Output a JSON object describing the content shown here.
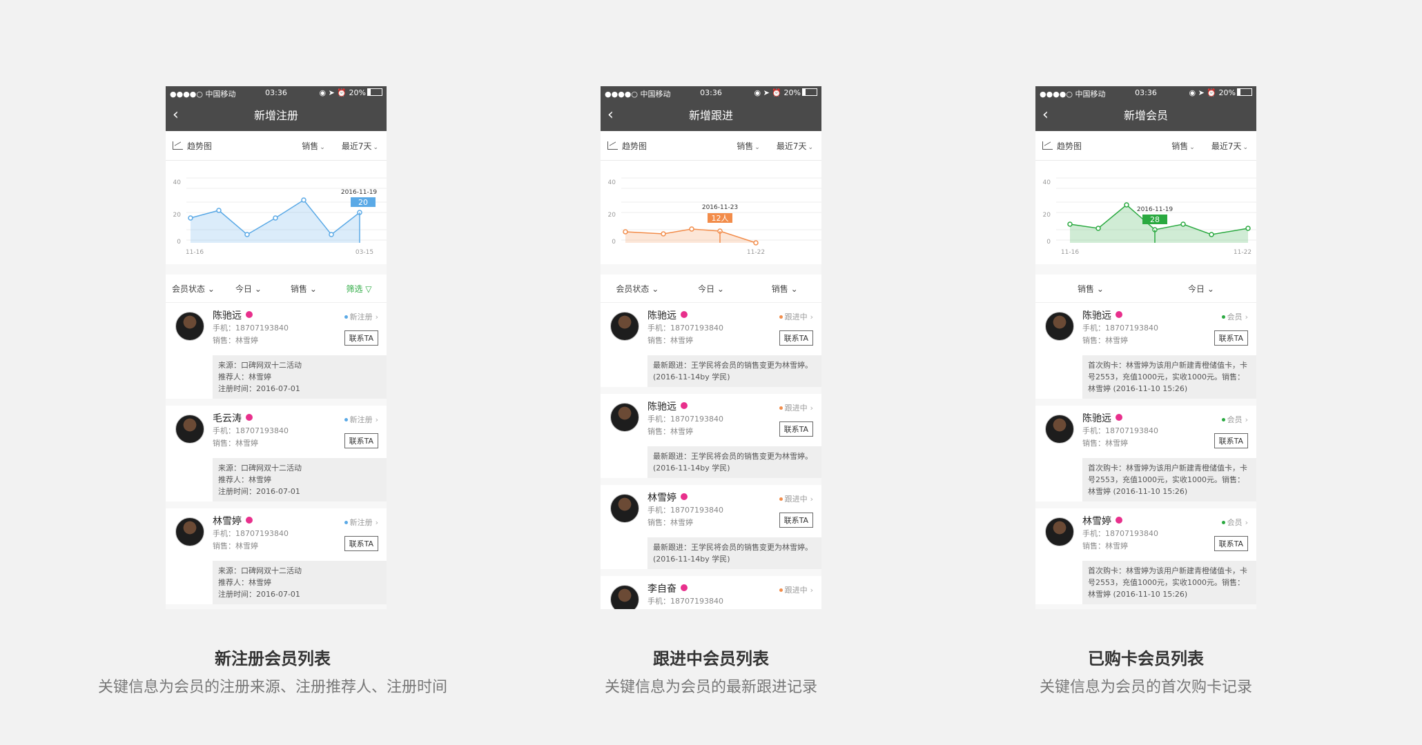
{
  "status_bar": {
    "carrier": "●●●●○ 中国移动",
    "time": "03:36",
    "right": "◉ ➤ ⏰ 20%"
  },
  "panels": [
    {
      "title": "新增注册",
      "trend_label": "趋势图",
      "sales_label": "销售",
      "range_label": "最近7天",
      "tabs": [
        "会员状态",
        "今日",
        "销售",
        "筛选"
      ],
      "chart": {
        "y_labels": [
          "40",
          "20",
          "0"
        ],
        "x_start": "11-16",
        "x_end": "03-15",
        "tooltip_date": "2016-11-19",
        "tooltip_value": "20"
      },
      "members": [
        {
          "name": "陈驰远",
          "phone": "手机：18707193840",
          "sales": "销售：林雪婷",
          "status": "新注册",
          "contact": "联系TA",
          "detail": [
            "来源：口碑网双十二活动",
            "推荐人：林雪婷",
            "注册时间：2016-07-01"
          ]
        },
        {
          "name": "毛云涛",
          "phone": "手机：18707193840",
          "sales": "销售：林雪婷",
          "status": "新注册",
          "contact": "联系TA",
          "detail": [
            "来源：口碑网双十二活动",
            "推荐人：林雪婷",
            "注册时间：2016-07-01"
          ]
        },
        {
          "name": "林雪婷",
          "phone": "手机：18707193840",
          "sales": "销售：林雪婷",
          "status": "新注册",
          "contact": "联系TA",
          "detail": [
            "来源：口碑网双十二活动",
            "推荐人：林雪婷",
            "注册时间：2016-07-01"
          ]
        }
      ],
      "caption": "新注册会员列表",
      "subcaption": "关键信息为会员的注册来源、注册推荐人、注册时间"
    },
    {
      "title": "新增跟进",
      "trend_label": "趋势图",
      "sales_label": "销售",
      "range_label": "最近7天",
      "tabs": [
        "会员状态",
        "今日",
        "销售"
      ],
      "chart": {
        "y_labels": [
          "40",
          "20",
          "0"
        ],
        "x_start": "",
        "x_end": "11-22",
        "tooltip_date": "2016-11-23",
        "tooltip_value": "12人"
      },
      "members": [
        {
          "name": "陈驰远",
          "phone": "手机：18707193840",
          "sales": "销售：林雪婷",
          "status": "跟进中",
          "contact": "联系TA",
          "detail": [
            "最新跟进：王学民将会员的销售变更为林雪婷。(2016-11-14by 学民)"
          ]
        },
        {
          "name": "陈驰远",
          "phone": "手机：18707193840",
          "sales": "销售：林雪婷",
          "status": "跟进中",
          "contact": "联系TA",
          "detail": [
            "最新跟进：王学民将会员的销售变更为林雪婷。(2016-11-14by 学民)"
          ]
        },
        {
          "name": "林雪婷",
          "phone": "手机：18707193840",
          "sales": "销售：林雪婷",
          "status": "跟进中",
          "contact": "联系TA",
          "detail": [
            "最新跟进：王学民将会员的销售变更为林雪婷。(2016-11-14by 学民)"
          ]
        },
        {
          "name": "李自奋",
          "phone": "手机：18707193840",
          "sales": "",
          "status": "跟进中",
          "contact": "",
          "detail": []
        }
      ],
      "caption": "跟进中会员列表",
      "subcaption": "关键信息为会员的最新跟进记录"
    },
    {
      "title": "新增会员",
      "trend_label": "趋势图",
      "sales_label": "销售",
      "range_label": "最近7天",
      "tabs": [
        "销售",
        "今日"
      ],
      "chart": {
        "y_labels": [
          "40",
          "20",
          "0"
        ],
        "x_start": "11-16",
        "x_end": "11-22",
        "tooltip_date": "2016-11-19",
        "tooltip_value": "28"
      },
      "members": [
        {
          "name": "陈驰远",
          "phone": "手机：18707193840",
          "sales": "销售：林雪婷",
          "status": "会员",
          "contact": "联系TA",
          "detail": [
            "首次购卡：林雪婷为该用户新建青橙储值卡，卡号2553，充值1000元，实收1000元。销售：林雪婷 (2016-11-10 15:26)"
          ]
        },
        {
          "name": "陈驰远",
          "phone": "手机：18707193840",
          "sales": "销售：林雪婷",
          "status": "会员",
          "contact": "联系TA",
          "detail": [
            "首次购卡：林雪婷为该用户新建青橙储值卡，卡号2553，充值1000元，实收1000元。销售：林雪婷 (2016-11-10 15:26)"
          ]
        },
        {
          "name": "林雪婷",
          "phone": "手机：18707193840",
          "sales": "销售：林雪婷",
          "status": "会员",
          "contact": "联系TA",
          "detail": [
            "首次购卡：林雪婷为该用户新建青橙储值卡，卡号2553，充值1000元，实收1000元。销售：林雪婷 (2016-11-10 15:26)"
          ]
        }
      ],
      "caption": "已购卡会员列表",
      "subcaption": "关键信息为会员的首次购卡记录"
    }
  ],
  "colors": {
    "panel0": "#5aa9e6",
    "panel1": "#f28c4a",
    "panel2": "#2aa940",
    "vip": "#e8308c"
  }
}
